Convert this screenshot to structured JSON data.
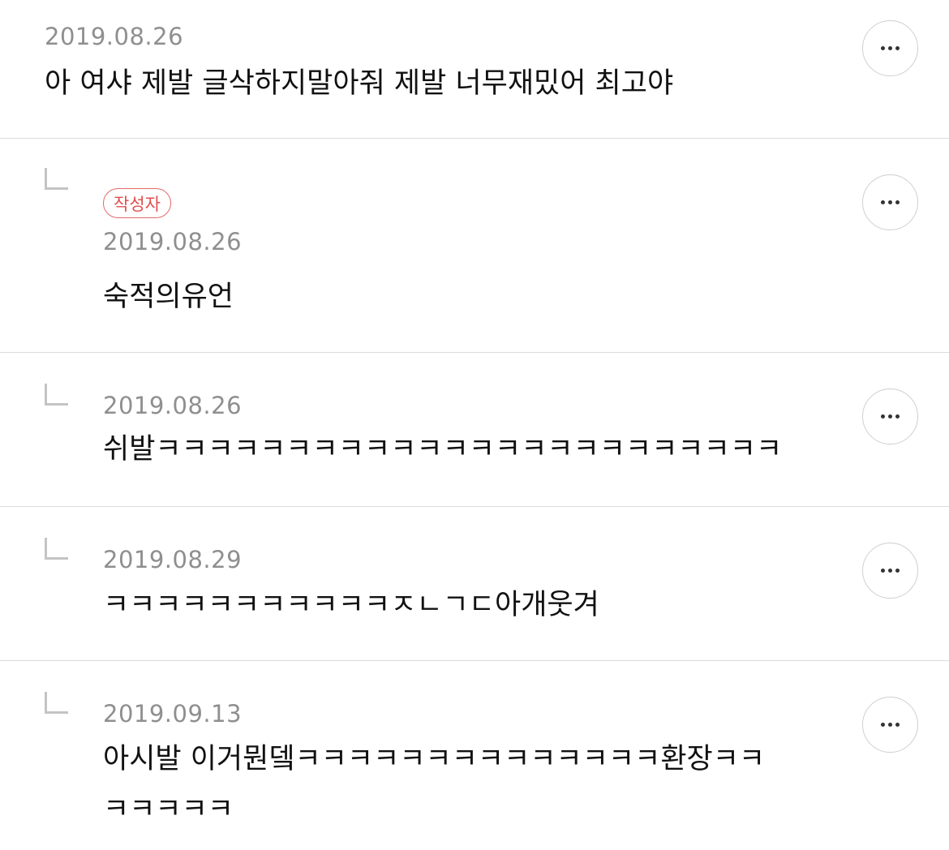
{
  "author_badge": "작성자",
  "comments": [
    {
      "date": "2019.08.26",
      "text": "아 여샤 제발 글삭하지말아줘 제발 너무재밌어 최고야"
    },
    {
      "date": "2019.08.26",
      "text": "숙적의유언"
    },
    {
      "date": "2019.08.26",
      "text": "쉬발ㅋㅋㅋㅋㅋㅋㅋㅋㅋㅋㅋㅋㅋㅋㅋㅋㅋㅋㅋㅋㅋㅋㅋㅋ"
    },
    {
      "date": "2019.08.29",
      "text": "ㅋㅋㅋㅋㅋㅋㅋㅋㅋㅋㅋㅈㄴㄱㄷ아개웃겨"
    },
    {
      "date": "2019.09.13",
      "text": "아시발 이거뭔뎈ㅋㅋㅋㅋㅋㅋㅋㅋㅋㅋㅋㅋㅋㅋ환장ㅋㅋ\nㅋㅋㅋㅋㅋ"
    }
  ],
  "icons": {
    "more": "more-horizontal-icon",
    "reply": "reply-arrow-icon"
  }
}
